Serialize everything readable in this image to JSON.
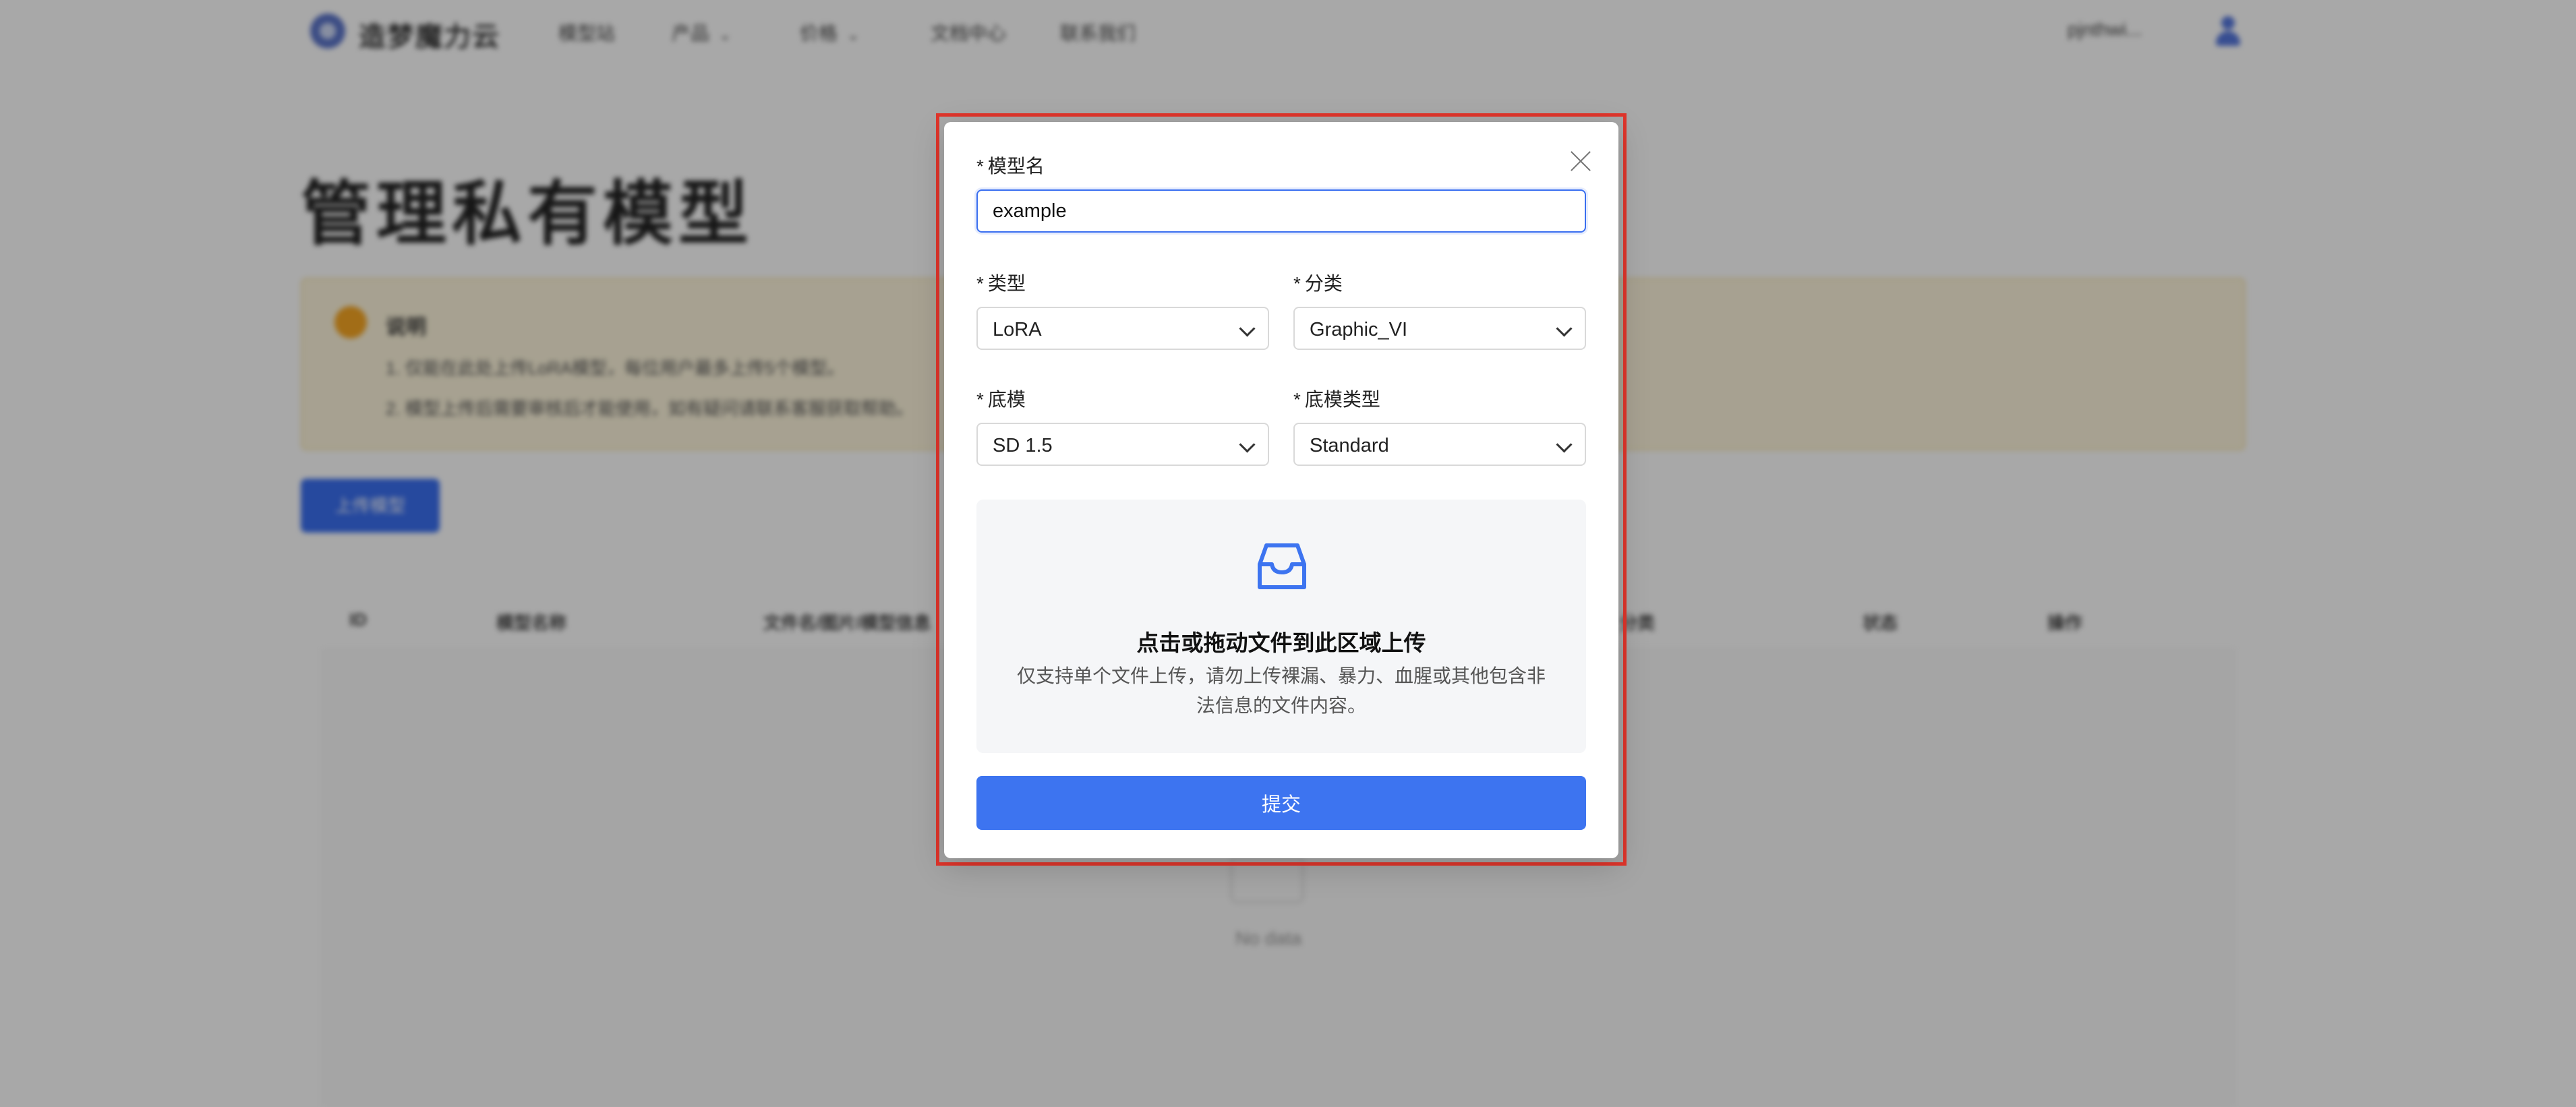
{
  "app": {
    "logo_text": "造梦魔力云",
    "nav": [
      {
        "label": "模型站"
      },
      {
        "label": "产品"
      },
      {
        "label": "价格"
      },
      {
        "label": "文档中心"
      },
      {
        "label": "联系我们"
      }
    ],
    "user_name": "pjnthwi..."
  },
  "page": {
    "title": "管理私有模型",
    "notice": {
      "title": "说明",
      "lines": [
        "1. 仅能在此处上传LoRA模型，每位用户最多上传5个模型。",
        "2. 模型上传后需要审核后才能使用，如有疑问请联系客服获取帮助。"
      ]
    },
    "upload_button": "上传模型",
    "table": {
      "headers": [
        "ID",
        "模型名称",
        "文件名/图片/模型信息",
        "分类",
        "状态",
        "操作"
      ],
      "empty_text": "No data"
    }
  },
  "modal": {
    "name_label": "模型名",
    "name_value": "example",
    "type_label": "类型",
    "type_value": "LoRA",
    "category_label": "分类",
    "category_value": "Graphic_VI",
    "base_label": "底模",
    "base_value": "SD 1.5",
    "base_type_label": "底模类型",
    "base_type_value": "Standard",
    "required_mark": "*",
    "upload_title": "点击或拖动文件到此区域上传",
    "upload_desc": "仅支持单个文件上传，请勿上传裸漏、暴力、血腥或其他包含非法信息的文件内容。",
    "submit_label": "提交",
    "icons": {
      "close": "close-icon",
      "upload": "inbox-icon",
      "dropdown": "chevron-down-icon"
    }
  },
  "colors": {
    "accent": "#3d74f0",
    "highlight_frame": "#e0352b",
    "notice_bg": "#fdf5dc"
  }
}
